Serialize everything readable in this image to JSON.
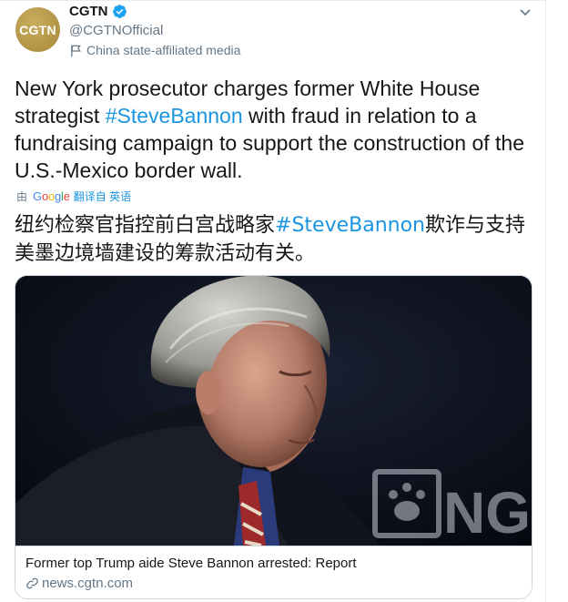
{
  "author": {
    "avatar_text": "CGTN",
    "display_name": "CGTN",
    "handle": "@CGTNOfficial",
    "affiliation": "China state-affiliated media"
  },
  "tweet": {
    "text_part1": "New York prosecutor charges former White House strategist ",
    "hashtag": "#SteveBannon",
    "text_part2": " with fraud in relation to a fundraising campaign to support the construction of the U.S.-Mexico border wall."
  },
  "translation": {
    "by_label": "由",
    "provider": "Google",
    "action_label": "翻译自 英语",
    "text_part1": "纽约检察官指控前白宫战略家",
    "hashtag": "#SteveBannon",
    "text_part2": "欺诈与支持美墨边境墙建设的筹款活动有关。"
  },
  "card": {
    "image_watermark": "NGA",
    "title": "Former top Trump aide Steve Bannon arrested: Report",
    "domain": "news.cgtn.com"
  },
  "colors": {
    "link": "#1b95e0",
    "text": "#14171a",
    "secondary": "#657786",
    "border": "#ccd6dd",
    "verified": "#1da1f2"
  },
  "icons": [
    "verified-badge-icon",
    "chevron-down-icon",
    "flag-icon",
    "link-icon"
  ]
}
